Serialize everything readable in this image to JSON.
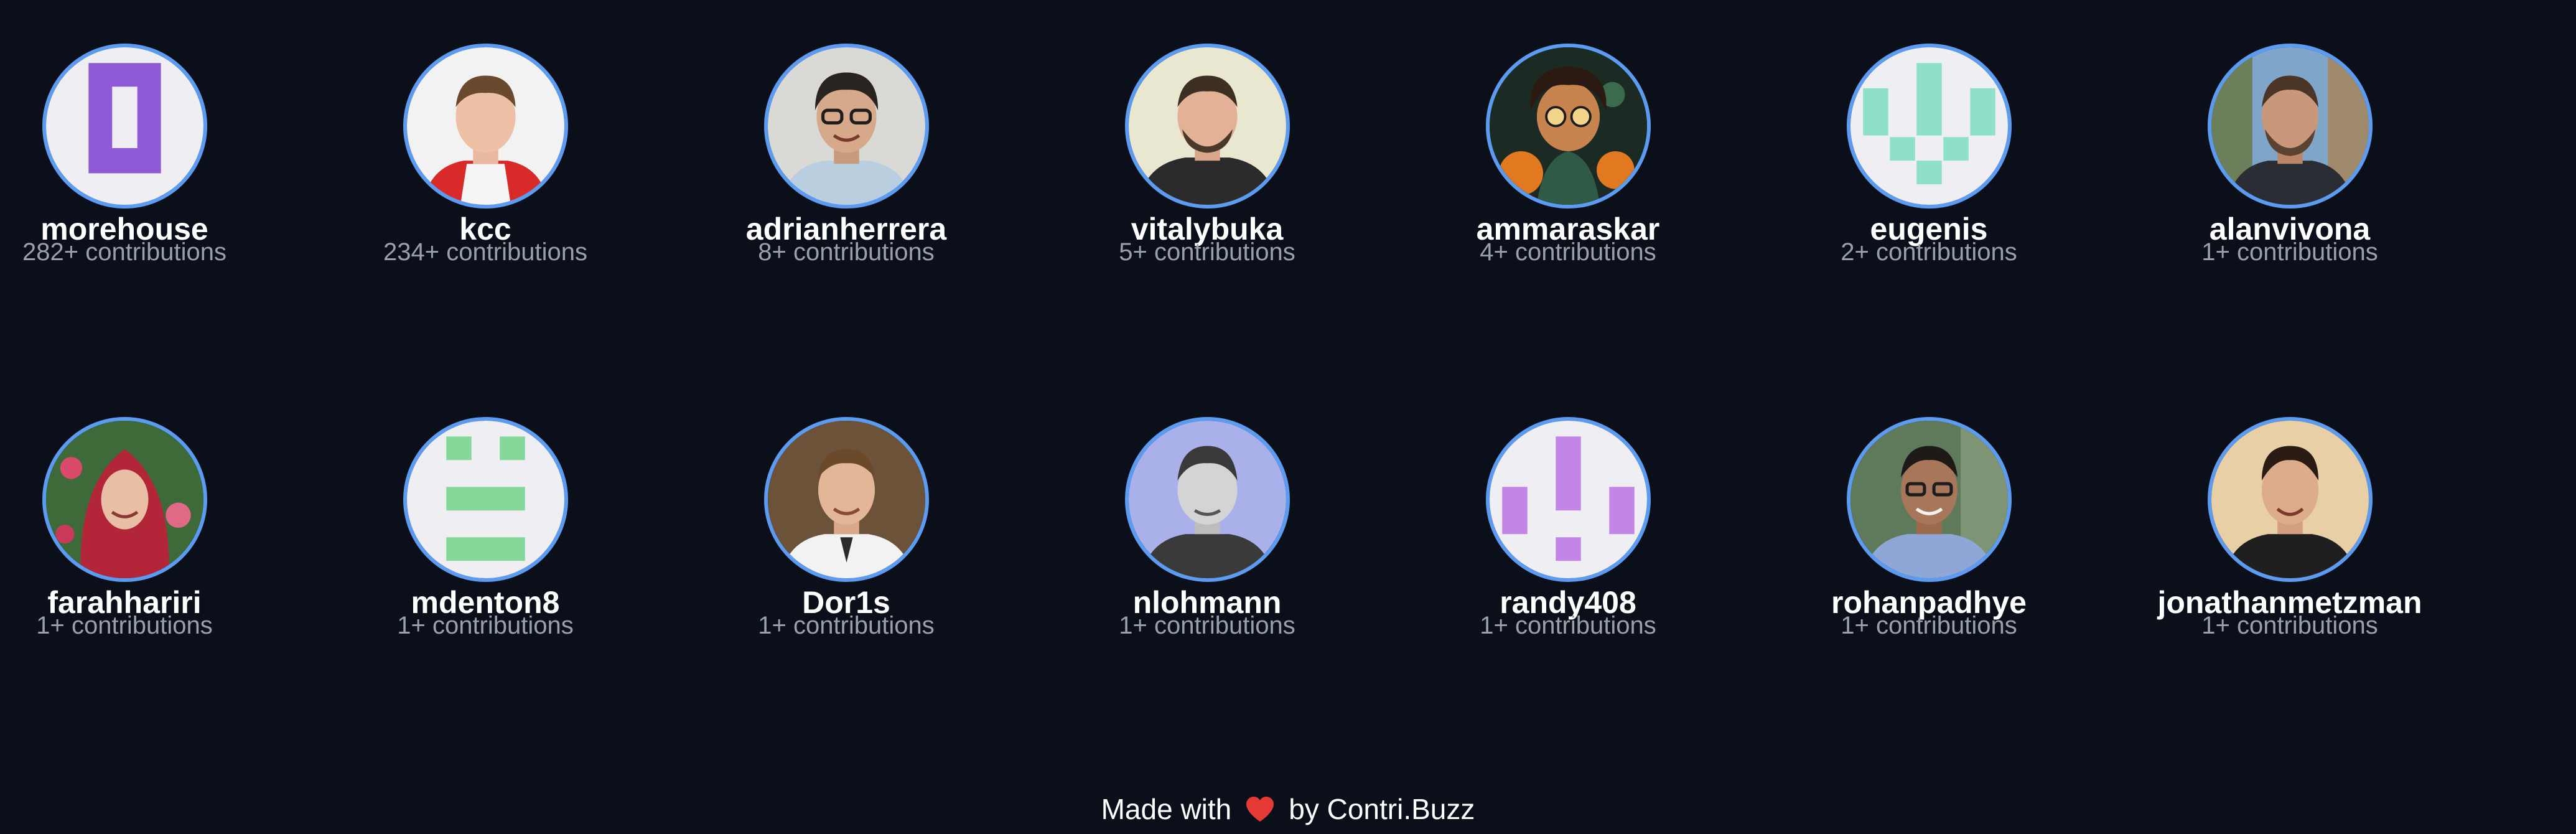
{
  "contributors": [
    {
      "username": "morehouse",
      "contributions": "282+ contributions",
      "avatar": "identicon-purple-icon",
      "accent": "#8e5ad6"
    },
    {
      "username": "kcc",
      "contributions": "234+ contributions",
      "avatar": "photo-avatar-icon"
    },
    {
      "username": "adrianherrera",
      "contributions": "8+ contributions",
      "avatar": "photo-avatar-icon"
    },
    {
      "username": "vitalybuka",
      "contributions": "5+ contributions",
      "avatar": "photo-avatar-icon"
    },
    {
      "username": "ammaraskar",
      "contributions": "4+ contributions",
      "avatar": "illustrated-avatar-icon"
    },
    {
      "username": "eugenis",
      "contributions": "2+ contributions",
      "avatar": "identicon-mint-icon",
      "accent": "#8fe0c9"
    },
    {
      "username": "alanvivona",
      "contributions": "1+ contributions",
      "avatar": "photo-avatar-icon"
    },
    {
      "username": "farahhariri",
      "contributions": "1+ contributions",
      "avatar": "photo-avatar-icon"
    },
    {
      "username": "mdenton8",
      "contributions": "1+ contributions",
      "avatar": "identicon-green-icon",
      "accent": "#84d99a"
    },
    {
      "username": "Dor1s",
      "contributions": "1+ contributions",
      "avatar": "photo-avatar-icon"
    },
    {
      "username": "nlohmann",
      "contributions": "1+ contributions",
      "avatar": "photo-avatar-icon"
    },
    {
      "username": "randy408",
      "contributions": "1+ contributions",
      "avatar": "identicon-lilac-icon",
      "accent": "#c386e6"
    },
    {
      "username": "rohanpadhye",
      "contributions": "1+ contributions",
      "avatar": "photo-avatar-icon"
    },
    {
      "username": "jonathanmetzman",
      "contributions": "1+ contributions",
      "avatar": "photo-avatar-icon"
    }
  ],
  "footer": {
    "made_with": "Made with",
    "by": "by Contri.Buzz",
    "heart_icon": "heart-icon",
    "heart_color": "#e53935"
  },
  "colors": {
    "background": "#0b0f19",
    "avatar_ring": "#5b9cf2",
    "name": "#ffffff",
    "contributions": "#9aa0ab"
  }
}
